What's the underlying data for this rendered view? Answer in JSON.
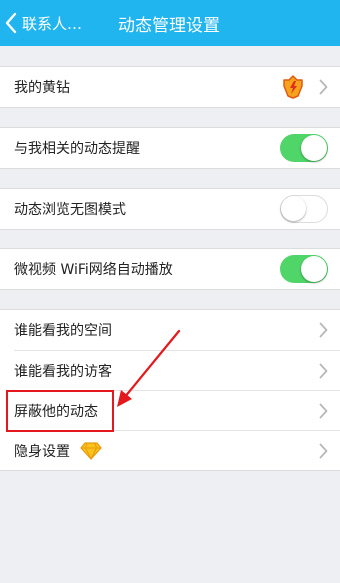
{
  "nav": {
    "back_label": "联系人…",
    "title": "动态管理设置",
    "background": "#21b5f0"
  },
  "groups": [
    {
      "items": [
        {
          "label": "我的黄钻",
          "icon": "yellow-diamond-vip-icon",
          "accessory": "chevron"
        }
      ]
    },
    {
      "items": [
        {
          "label": "与我相关的动态提醒",
          "toggle": true
        }
      ]
    },
    {
      "items": [
        {
          "label": "动态浏览无图模式",
          "toggle": false
        }
      ]
    },
    {
      "items": [
        {
          "label": "微视频 WiFi网络自动播放",
          "toggle": true
        }
      ]
    },
    {
      "items": [
        {
          "label": "谁能看我的空间",
          "accessory": "chevron"
        },
        {
          "label": "谁能看我的访客",
          "accessory": "chevron"
        },
        {
          "label": "屏蔽他的动态",
          "accessory": "chevron",
          "highlighted": true
        },
        {
          "label": "隐身设置",
          "icon": "diamond-icon",
          "accessory": "chevron"
        }
      ]
    }
  ],
  "colors": {
    "toggle_on": "#4fd568",
    "annotation": "#e3191d",
    "page_background": "#eeeff3"
  }
}
